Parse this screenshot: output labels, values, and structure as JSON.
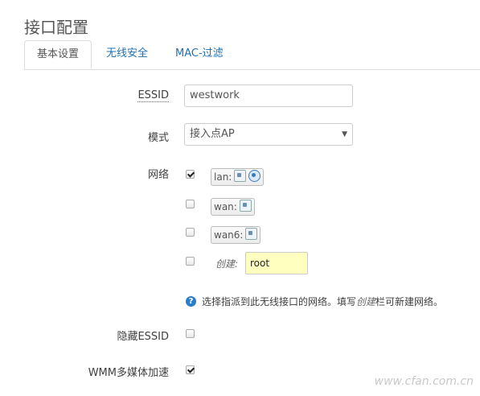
{
  "page": {
    "title": "接口配置"
  },
  "tabs": [
    {
      "label": "基本设置",
      "active": true
    },
    {
      "label": "无线安全",
      "active": false
    },
    {
      "label": "MAC-过滤",
      "active": false
    }
  ],
  "form": {
    "essid": {
      "label": "ESSID",
      "value": "westwork"
    },
    "mode": {
      "label": "模式",
      "value": "接入点AP",
      "caret": "▼"
    },
    "network": {
      "label": "网络",
      "options": [
        {
          "name": "lan:",
          "checked": true,
          "icons": [
            "ethernet-icon",
            "wifi-icon"
          ]
        },
        {
          "name": "wan:",
          "checked": false,
          "icons": [
            "ethernet-icon"
          ]
        },
        {
          "name": "wan6:",
          "checked": false,
          "icons": [
            "ethernet-icon"
          ]
        }
      ],
      "create": {
        "label": "创建:",
        "value": "root",
        "checked": false
      },
      "help": {
        "icon": "?",
        "text_before": "选择指派到此无线接口的网络。填写",
        "text_em": "创建",
        "text_after": "栏可新建网络。"
      }
    },
    "hide_essid": {
      "label": "隐藏ESSID",
      "checked": false
    },
    "wmm": {
      "label": "WMM多媒体加速",
      "checked": true
    }
  },
  "watermark": "www.cfan.com.cn"
}
